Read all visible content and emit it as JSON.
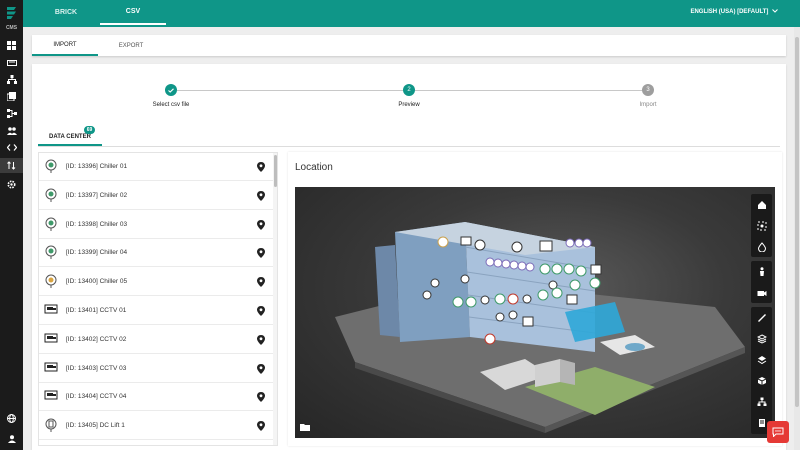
{
  "app": {
    "short_name": "CMS"
  },
  "top_tabs": [
    {
      "label": "BRICK",
      "active": false
    },
    {
      "label": "CSV",
      "active": true
    }
  ],
  "language": "ENGLISH (USA) [DEFAULT]",
  "sub_tabs": [
    {
      "label": "IMPORT",
      "active": true
    },
    {
      "label": "EXPORT",
      "active": false
    }
  ],
  "stepper": [
    {
      "label": "Select csv file",
      "number": "1",
      "state": "done"
    },
    {
      "label": "Preview",
      "number": "2",
      "state": "active"
    },
    {
      "label": "Import",
      "number": "3",
      "state": "pending"
    }
  ],
  "data_center_tab": {
    "label": "DATA CENTER",
    "badge": "69"
  },
  "items": [
    {
      "label": "[ID: 13396] Chiller 01",
      "icon": "chiller-icon"
    },
    {
      "label": "[ID: 13397] Chiller 02",
      "icon": "chiller-icon"
    },
    {
      "label": "[ID: 13398] Chiller 03",
      "icon": "chiller-icon"
    },
    {
      "label": "[ID: 13399] Chiller 04",
      "icon": "chiller-icon"
    },
    {
      "label": "[ID: 13400] Chiller 05",
      "icon": "chiller-icon"
    },
    {
      "label": "[ID: 13401] CCTV 01",
      "icon": "cctv-icon"
    },
    {
      "label": "[ID: 13402] CCTV 02",
      "icon": "cctv-icon"
    },
    {
      "label": "[ID: 13403] CCTV 03",
      "icon": "cctv-icon"
    },
    {
      "label": "[ID: 13404] CCTV 04",
      "icon": "cctv-icon"
    },
    {
      "label": "[ID: 13405] DC Lift 1",
      "icon": "lift-icon"
    }
  ],
  "location": {
    "title": "Location"
  },
  "viewer_tools_group1": [
    "home-icon",
    "focus-icon",
    "drop-icon"
  ],
  "viewer_tools_group2": [
    "person-icon",
    "camera-icon"
  ],
  "viewer_tools_group3": [
    "ruler-icon",
    "section-icon",
    "layers-icon",
    "cube-icon",
    "tree-icon",
    "document-icon"
  ],
  "colors": {
    "accent": "#0f9688",
    "rail": "#1b1b1b",
    "chat": "#e53935"
  }
}
